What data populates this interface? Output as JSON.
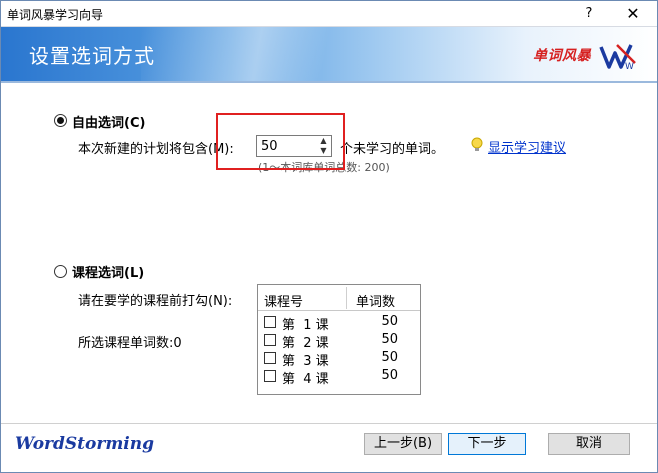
{
  "window": {
    "title": "单词风暴学习向导",
    "help_label": "?",
    "close_label": "✕"
  },
  "banner": {
    "heading": "设置选词方式",
    "logo_text": "单词风暴",
    "logo_mark_text": "W"
  },
  "free_mode": {
    "label": "自由选词(C)",
    "selected": true,
    "prompt": "本次新建的计划将包含(M):",
    "value": "50",
    "suffix": "个未学习的单词。",
    "hint": "(1～本词库单词总数: 200)",
    "advice_link": "显示学习建议"
  },
  "course_mode": {
    "label": "课程选词(L)",
    "selected": false,
    "prompt": "请在要学的课程前打勾(N):",
    "selected_count": "所选课程单词数:0",
    "columns": [
      "课程号",
      "单词数"
    ],
    "rows": [
      {
        "name": "第  1 课",
        "count": "50",
        "checked": false
      },
      {
        "name": "第  2 课",
        "count": "50",
        "checked": false
      },
      {
        "name": "第  3 课",
        "count": "50",
        "checked": false
      },
      {
        "name": "第  4 课",
        "count": "50",
        "checked": false
      }
    ]
  },
  "footer": {
    "brand": "WordStorming",
    "back_label": "上一步(B)",
    "next_label": "下一步",
    "cancel_label": "取消"
  },
  "colors": {
    "highlight_box": "#e02020",
    "link": "#0033cc",
    "brand": "#1a3aa0",
    "logo": "#d62020"
  }
}
